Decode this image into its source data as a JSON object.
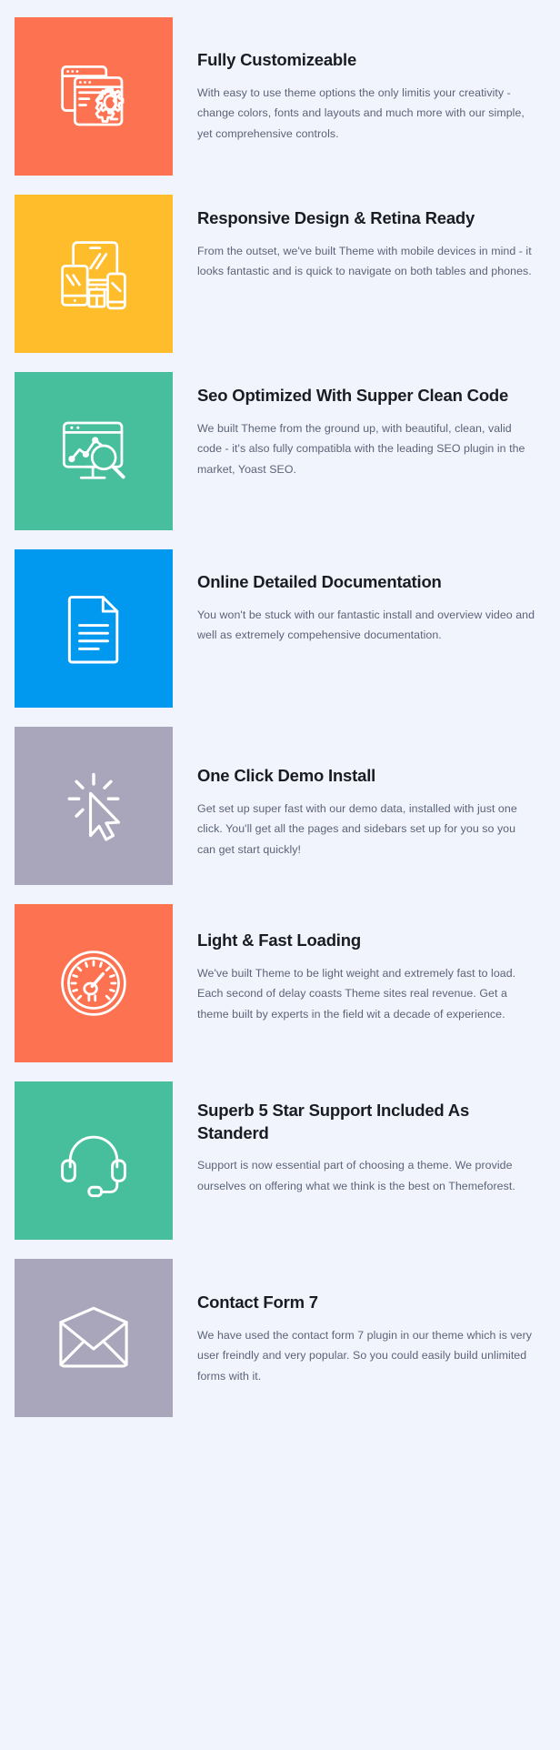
{
  "page": {
    "background_color": "#f1f4fd",
    "title_color": "#1b1b23",
    "desc_color": "#5c6378"
  },
  "features": [
    {
      "icon": "browser-windows-gear-icon",
      "tile_color": "#fd7351",
      "title": "Fully Customizeable",
      "desc": "With easy to use theme options the only limitis your creativity - change colors, fonts and layouts and much more with our simple, yet comprehensive controls."
    },
    {
      "icon": "responsive-devices-icon",
      "tile_color": "#ffbc2b",
      "title": "Responsive Design & Retina Ready",
      "desc": "From the outset, we've built Theme with mobile devices in mind - it looks fantastic and is quick to navigate on both tables and phones."
    },
    {
      "icon": "seo-monitor-magnifier-icon",
      "tile_color": "#47bf9c",
      "title": "Seo Optimized With Supper Clean Code",
      "desc": "We built Theme from the ground up, with beautiful, clean, valid code - it's also fully compatibla with the leading SEO plugin in the market, Yoast SEO."
    },
    {
      "icon": "document-page-icon",
      "tile_color": "#0099ef",
      "title": "Online Detailed Documentation",
      "desc": "You won't be stuck with our fantastic install and overview video and well as extremely compehensive documentation."
    },
    {
      "icon": "cursor-click-icon",
      "tile_color": "#a9a5bb",
      "title": "One Click Demo Install",
      "desc": "Get set up super fast with our demo data, installed with just one click. You'll get all the pages and sidebars set up for you so you can get start quickly!"
    },
    {
      "icon": "speedometer-icon",
      "tile_color": "#fd7351",
      "title": "Light & Fast Loading",
      "desc": "We've built Theme to be light weight and extremely fast to load. Each second of delay coasts Theme sites real revenue. Get a theme built by experts in the field wit a decade of experience."
    },
    {
      "icon": "headset-support-icon",
      "tile_color": "#47bf9c",
      "title": "Superb 5 Star Support Included As Standerd",
      "desc": "Support is now essential part of choosing a theme. We provide ourselves on offering what we think is the best on Themeforest."
    },
    {
      "icon": "envelope-mail-icon",
      "tile_color": "#a9a5bb",
      "title": "Contact Form 7",
      "desc": "We have used the contact form 7 plugin in our theme which is very user freindly and very popular. So you could easily build unlimited forms with it."
    }
  ]
}
